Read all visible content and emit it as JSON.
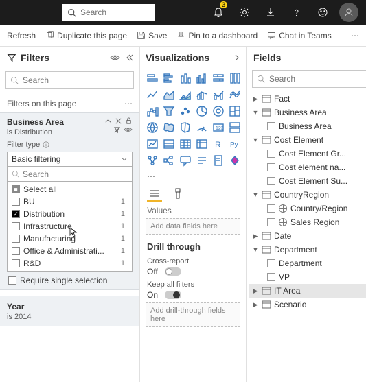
{
  "topbar": {
    "search_placeholder": "Search",
    "notification_count": "3"
  },
  "toolbar": {
    "refresh": "Refresh",
    "duplicate": "Duplicate this page",
    "save": "Save",
    "pin": "Pin to a dashboard",
    "chat": "Chat in Teams"
  },
  "filters": {
    "title": "Filters",
    "search_placeholder": "Search",
    "page_filters_label": "Filters on this page",
    "card": {
      "name": "Business Area",
      "state": "is Distribution",
      "filter_type_label": "Filter type",
      "dropdown_value": "Basic filtering",
      "inner_search": "Search",
      "options": [
        {
          "label": "Select all",
          "checked": "all",
          "count": ""
        },
        {
          "label": "BU",
          "checked": "",
          "count": "1"
        },
        {
          "label": "Distribution",
          "checked": "yes",
          "count": "1"
        },
        {
          "label": "Infrastructure",
          "checked": "",
          "count": "1"
        },
        {
          "label": "Manufacturing",
          "checked": "",
          "count": "1"
        },
        {
          "label": "Office & Administrati...",
          "checked": "",
          "count": "1"
        },
        {
          "label": "R&D",
          "checked": "",
          "count": "1"
        }
      ],
      "require_single": "Require single selection"
    },
    "year_card": {
      "name": "Year",
      "state": "is 2014"
    }
  },
  "viz": {
    "title": "Visualizations",
    "values_label": "Values",
    "values_placeholder": "Add data fields here",
    "drill_title": "Drill through",
    "cross_label": "Cross-report",
    "cross_state": "Off",
    "keep_label": "Keep all filters",
    "keep_state": "On",
    "drill_placeholder": "Add drill-through fields here"
  },
  "fields": {
    "title": "Fields",
    "search_placeholder": "Search",
    "tree": {
      "fact": "Fact",
      "business_area": "Business Area",
      "business_area_child": "Business Area",
      "cost_element": "Cost Element",
      "cost_element_c1": "Cost Element Gr...",
      "cost_element_c2": "Cost element na...",
      "cost_element_c3": "Cost Element Su...",
      "country": "CountryRegion",
      "country_c1": "Country/Region",
      "country_c2": "Sales Region",
      "date": "Date",
      "dept": "Department",
      "dept_c1": "Department",
      "dept_c2": "VP",
      "it_area": "IT Area",
      "scenario": "Scenario"
    }
  }
}
